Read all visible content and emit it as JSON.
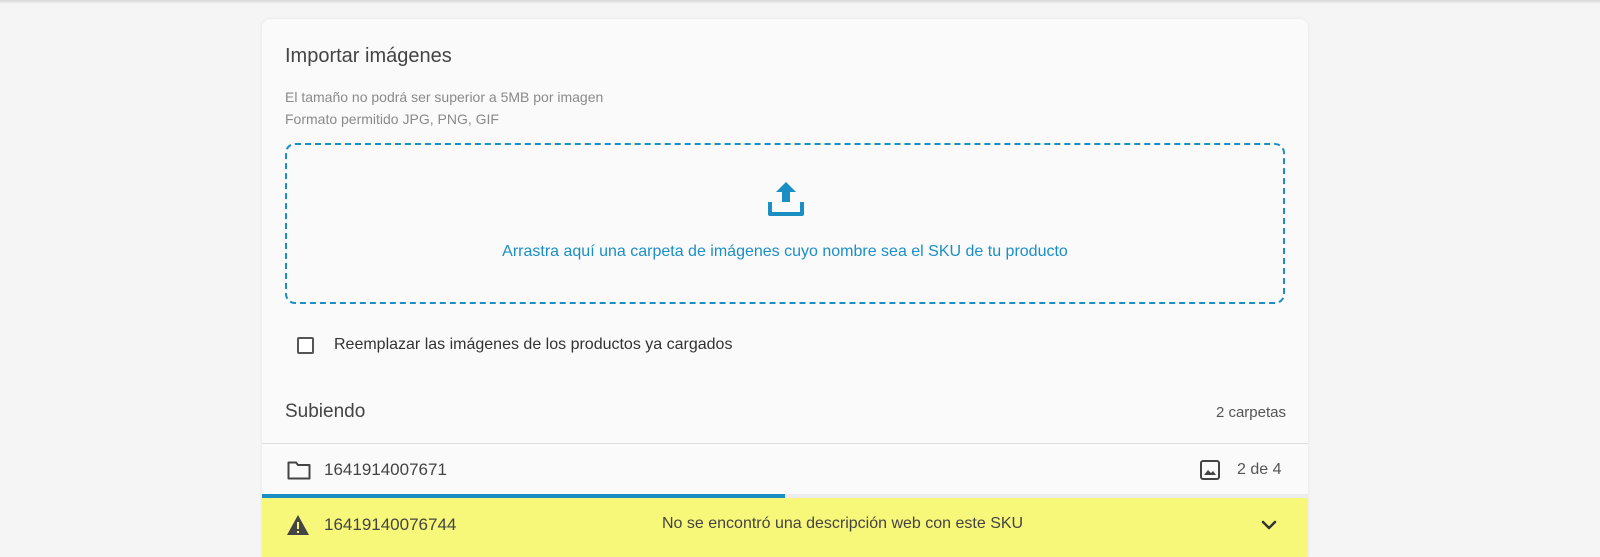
{
  "import": {
    "title": "Importar imágenes",
    "hint_size": "El tamaño no podrá ser superior a 5MB por imagen",
    "hint_format": "Formato permitido JPG, PNG, GIF",
    "dropzone_text": "Arrastra aquí una carpeta de imágenes cuyo nombre sea el SKU de tu producto",
    "dropzone_icon": "upload-icon",
    "accent_color": "#1b8fc4"
  },
  "replace_option": {
    "label": "Reemplazar las imágenes de los productos ya cargados",
    "checked": false
  },
  "uploading": {
    "title": "Subiendo",
    "count": "2 carpetas",
    "items": [
      {
        "icon": "folder-icon",
        "id": "1641914007671",
        "progress_icon": "image-icon",
        "progress_text": "2 de 4",
        "progress_fraction": 0.5
      },
      {
        "icon": "warning-icon",
        "id": "16419140076744",
        "message": "No se encontró una descripción web con este SKU",
        "status_color": "#f7f77a",
        "expand_icon": "chevron-down-icon"
      }
    ]
  }
}
